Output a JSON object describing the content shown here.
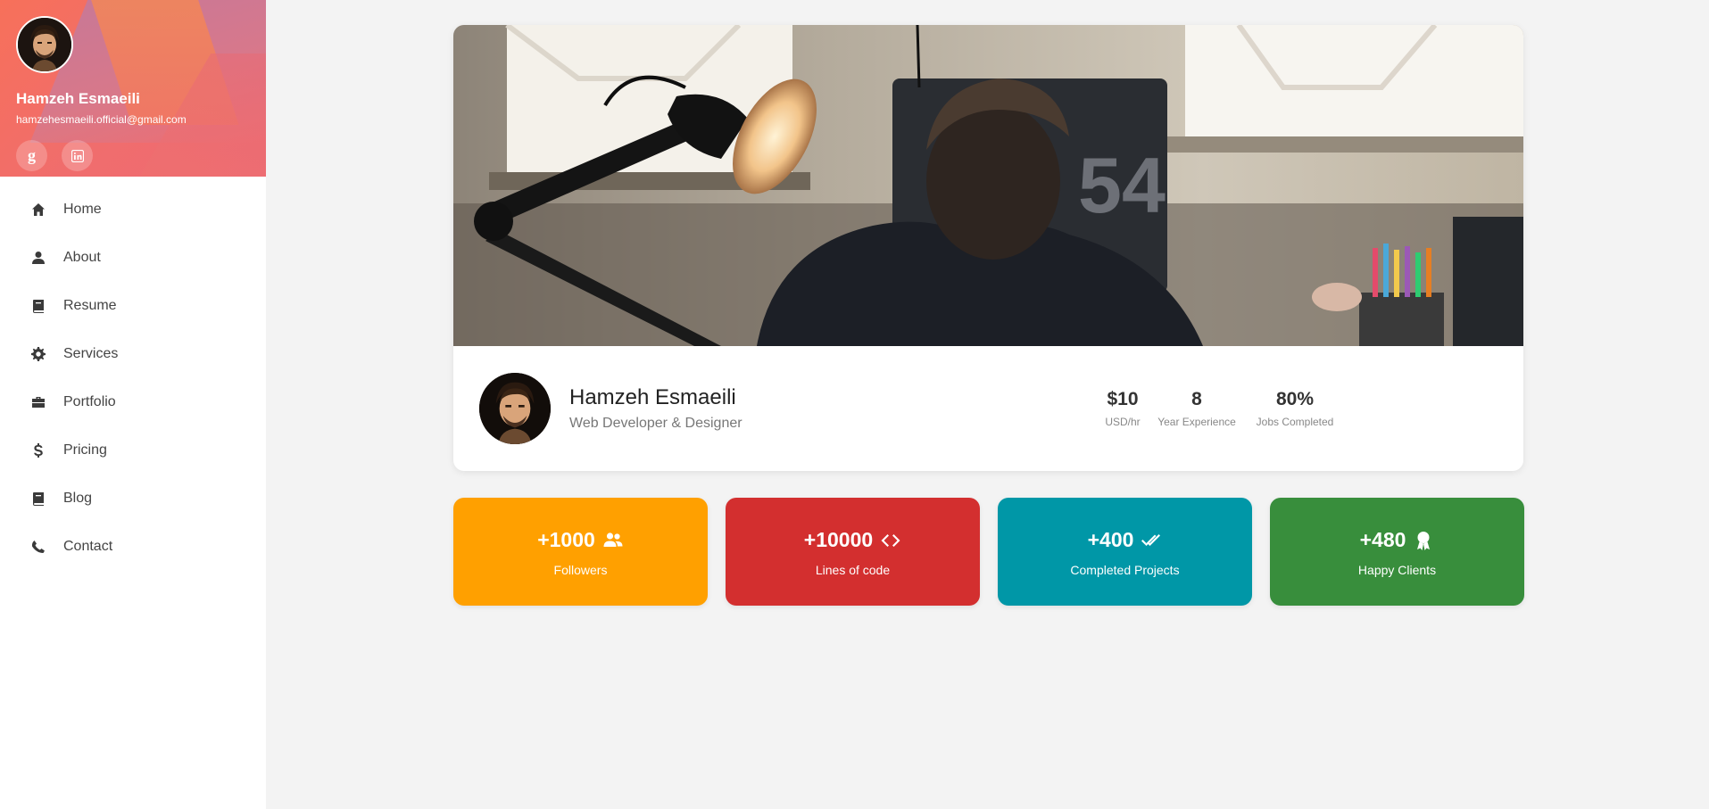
{
  "sidebar": {
    "name": "Hamzeh Esmaeili",
    "email": "hamzehesmaeili.official@gmail.com",
    "socials": [
      {
        "icon": "google-icon",
        "glyph": "g"
      },
      {
        "icon": "linkedin-icon"
      }
    ],
    "nav": [
      {
        "label": "Home",
        "icon": "home-icon"
      },
      {
        "label": "About",
        "icon": "person-icon"
      },
      {
        "label": "Resume",
        "icon": "book-icon"
      },
      {
        "label": "Services",
        "icon": "gear-icon"
      },
      {
        "label": "Portfolio",
        "icon": "briefcase-icon"
      },
      {
        "label": "Pricing",
        "icon": "dollar-icon"
      },
      {
        "label": "Blog",
        "icon": "book-icon"
      },
      {
        "label": "Contact",
        "icon": "phone-icon"
      }
    ]
  },
  "profile": {
    "name": "Hamzeh Esmaeili",
    "title": "Web Developer & Designer",
    "stats": [
      {
        "value": "$10",
        "label": "USD/hr"
      },
      {
        "value": "8",
        "label": "Year Experience"
      },
      {
        "value": "80%",
        "label": "Jobs Completed"
      }
    ]
  },
  "counters": [
    {
      "value": "+1000",
      "label": "Followers",
      "icon": "users-icon",
      "color": "#ffa000"
    },
    {
      "value": "+10000",
      "label": "Lines of code",
      "icon": "code-icon",
      "color": "#d32f2f"
    },
    {
      "value": "+400",
      "label": "Completed Projects",
      "icon": "double-check-icon",
      "color": "#0097a7"
    },
    {
      "value": "+480",
      "label": "Happy Clients",
      "icon": "award-icon",
      "color": "#388e3c"
    }
  ]
}
